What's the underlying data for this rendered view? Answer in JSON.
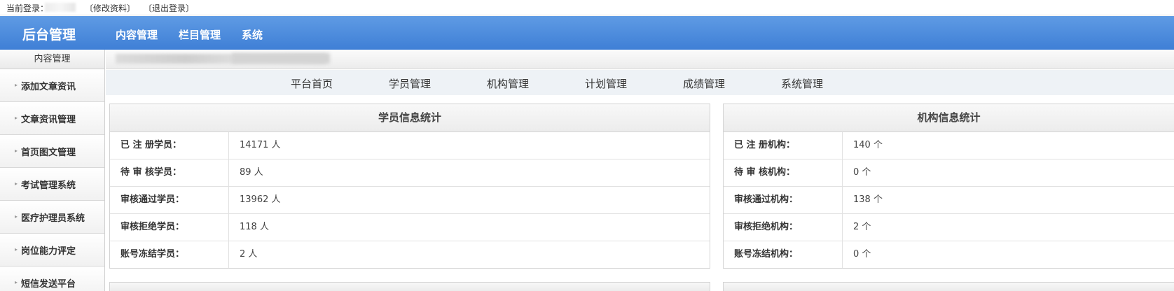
{
  "topbar": {
    "login_label": "当前登录：",
    "edit_profile": "〔修改资料〕",
    "logout": "〔退出登录〕"
  },
  "header": {
    "brand": "后台管理",
    "nav": [
      "内容管理",
      "栏目管理",
      "系统"
    ]
  },
  "sidebar": {
    "title": "内容管理",
    "items": [
      "添加文章资讯",
      "文章资讯管理",
      "首页图文管理",
      "考试管理系统",
      "医疗护理员系统",
      "岗位能力评定",
      "短信发送平台"
    ]
  },
  "subnav": [
    "平台首页",
    "学员管理",
    "机构管理",
    "计划管理",
    "成绩管理",
    "系统管理"
  ],
  "student_stats": {
    "title": "学员信息统计",
    "rows": [
      {
        "label": "已 注 册学员：",
        "value": "14171 人"
      },
      {
        "label": "待 审 核学员：",
        "value": "89 人"
      },
      {
        "label": "审核通过学员：",
        "value": "13962 人"
      },
      {
        "label": "审核拒绝学员：",
        "value": "118 人"
      },
      {
        "label": "账号冻结学员：",
        "value": "2 人"
      }
    ]
  },
  "org_stats": {
    "title": "机构信息统计",
    "rows": [
      {
        "label": "已 注 册机构：",
        "value": "140 个"
      },
      {
        "label": "待 审 核机构：",
        "value": "0 个"
      },
      {
        "label": "审核通过机构：",
        "value": "138 个"
      },
      {
        "label": "审核拒绝机构：",
        "value": "2 个"
      },
      {
        "label": "账号冻结机构：",
        "value": "0 个"
      }
    ]
  },
  "colors": {
    "header_top": "#5f9be4",
    "header_bottom": "#3f7fd6",
    "subnav_bg": "#eef2f6"
  }
}
